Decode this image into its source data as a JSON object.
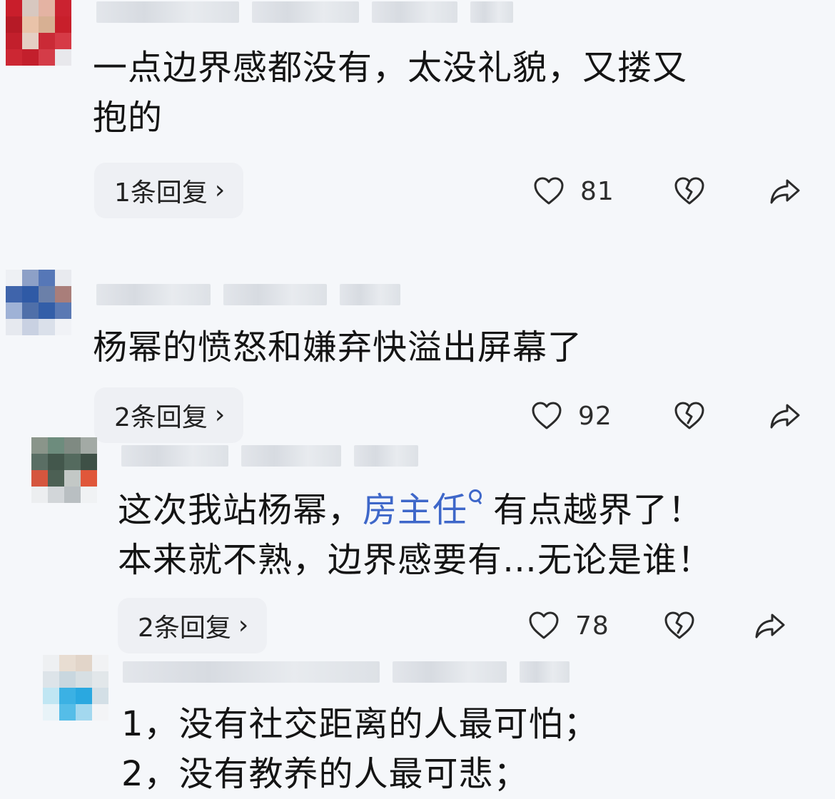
{
  "comments": [
    {
      "text": "一点边界感都没有，太没礼貌，又搂又\n抱的",
      "reply_label": "1条回复",
      "likes": "81"
    },
    {
      "text": "杨幂的愤怒和嫌弃快溢出屏幕了",
      "reply_label": "2条回复",
      "likes": "92"
    },
    {
      "text_part1": "这次我站杨幂，",
      "link_text": "房主任",
      "text_part2": "有点越界了！\n本来就不熟，边界感要有…无论是谁！",
      "reply_label": "2条回复",
      "likes": "78"
    },
    {
      "text": "1，没有社交距离的人最可怕；\n2，没有教养的人最可悲；"
    }
  ],
  "icons": {
    "like": "heart-outline-icon",
    "dislike": "broken-heart-icon",
    "share": "share-arrow-icon",
    "reply_chevron": "chevron-right-icon"
  },
  "colors": {
    "background": "#f5f7fa",
    "link": "#3e67c9",
    "text": "#141414",
    "icon": "#2b2b2b"
  }
}
